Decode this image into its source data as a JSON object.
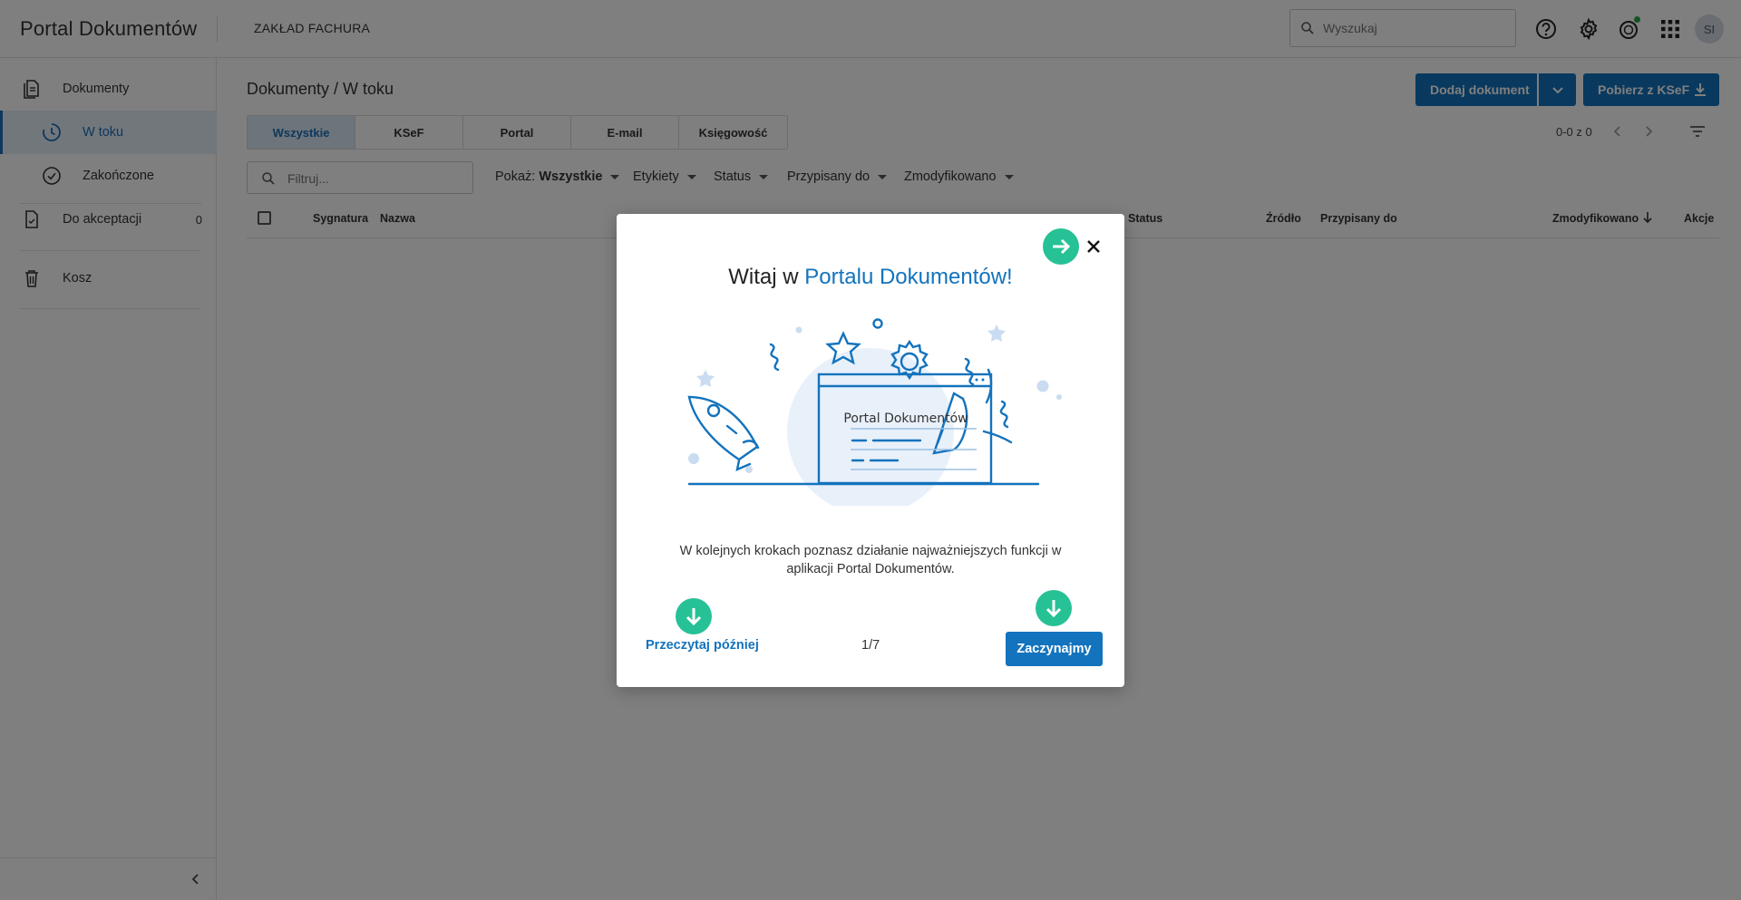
{
  "topbar": {
    "app_title": "Portal Dokumentów",
    "company": "ZAKŁAD FACHURA",
    "search_placeholder": "Wyszukaj",
    "avatar_initials": "SI",
    "icons": [
      "help-icon",
      "gear-icon",
      "notifications-icon",
      "apps-grid-icon"
    ]
  },
  "sidebar": {
    "items": [
      {
        "label": "Dokumenty",
        "icon": "document-icon"
      },
      {
        "label": "W toku",
        "icon": "clock-icon"
      },
      {
        "label": "Zakończone",
        "icon": "check-circle-icon"
      },
      {
        "label": "Do akceptacji",
        "icon": "document-check-icon",
        "count": "0"
      },
      {
        "label": "Kosz",
        "icon": "trash-icon"
      }
    ]
  },
  "main": {
    "breadcrumb": "Dokumenty / W toku",
    "add_document_label": "Dodaj dokument",
    "ksef_download_label": "Pobierz z KSeF",
    "tabs": [
      "Wszystkie",
      "KSeF",
      "Portal",
      "E-mail",
      "Księgowość"
    ],
    "pager": "0-0 z 0",
    "filter_placeholder": "Filtruj...",
    "filters": {
      "show_label": "Pokaż:",
      "show_value": "Wszystkie",
      "labels": "Etykiety",
      "status": "Status",
      "assigned": "Przypisany do",
      "modified": "Zmodyfikowano"
    },
    "columns": [
      "Sygnatura",
      "Nazwa",
      "Status",
      "Źródło",
      "Przypisany do",
      "Zmodyfikowano",
      "Akcje"
    ]
  },
  "modal": {
    "title_prefix": "Witaj w ",
    "title_accent": "Portalu Dokumentów!",
    "illustration_caption": "Portal Dokumentów",
    "body": "W kolejnych krokach poznasz działanie najważniejszych funkcji w aplikacji Portal Dokumentów.",
    "read_later": "Przeczytaj później",
    "step": "1/7",
    "start": "Zaczynajmy"
  },
  "colors": {
    "accent": "#1373bd",
    "hint": "#27c196"
  }
}
